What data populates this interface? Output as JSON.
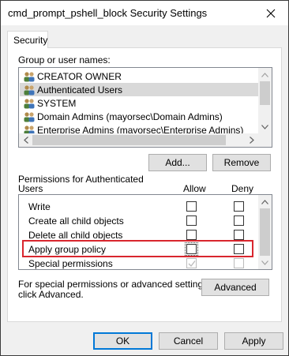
{
  "window": {
    "title": "cmd_prompt_pshell_block Security Settings"
  },
  "tabs": [
    {
      "label": "Security"
    }
  ],
  "groups": {
    "label": "Group or user names:",
    "items": [
      {
        "label": "CREATOR OWNER",
        "selected": false
      },
      {
        "label": "Authenticated Users",
        "selected": true
      },
      {
        "label": "SYSTEM",
        "selected": false
      },
      {
        "label": "Domain Admins (mayorsec\\Domain Admins)",
        "selected": false
      },
      {
        "label": "Enterprise Admins (mayorsec\\Enterprise Admins)",
        "selected": false
      }
    ]
  },
  "buttons": {
    "add": "Add...",
    "remove": "Remove",
    "advanced": "Advanced",
    "ok": "OK",
    "cancel": "Cancel",
    "apply": "Apply"
  },
  "permissions": {
    "label_line1": "Permissions for Authenticated",
    "label_line2": "Users",
    "allow_header": "Allow",
    "deny_header": "Deny",
    "rows": [
      {
        "name": "Write",
        "allow": false,
        "deny": false
      },
      {
        "name": "Create all child objects",
        "allow": false,
        "deny": false
      },
      {
        "name": "Delete all child objects",
        "allow": false,
        "deny": false
      },
      {
        "name": "Apply group policy",
        "allow": false,
        "deny": false,
        "highlighted": true
      },
      {
        "name": "Special permissions",
        "allow": true,
        "deny": false,
        "disabled": true
      }
    ]
  },
  "advanced_text": {
    "line1": "For special permissions or advanced settings,",
    "line2": "click Advanced."
  },
  "colors": {
    "highlight_border": "#d9262e",
    "selected_row": "#d9d9d9",
    "default_button_border": "#0078d7"
  }
}
